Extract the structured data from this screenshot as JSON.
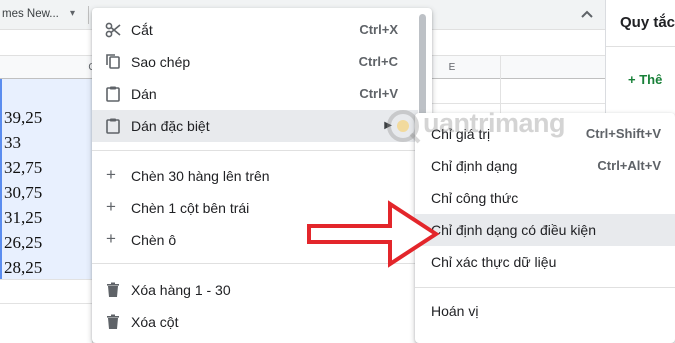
{
  "toolbar": {
    "font_name": "mes New...",
    "font_caret": "▾"
  },
  "columns": {
    "c_label": "C",
    "e_label": "E"
  },
  "cells": [
    "39,25",
    "33",
    "32,75",
    "30,75",
    "31,25",
    "26,25",
    "28,25"
  ],
  "side_panel": {
    "title": "Quy tắc",
    "add_label": "+ Thê"
  },
  "context_menu": {
    "items": [
      {
        "label": "Cắt",
        "shortcut": "Ctrl+X",
        "icon": "scissors-icon"
      },
      {
        "label": "Sao chép",
        "shortcut": "Ctrl+C",
        "icon": "copy-icon"
      },
      {
        "label": "Dán",
        "shortcut": "Ctrl+V",
        "icon": "clipboard-icon"
      },
      {
        "label": "Dán đặc biệt",
        "shortcut": "",
        "icon": "clipboard-icon",
        "submenu_arrow": "▶"
      },
      {
        "label": "Chèn 30 hàng lên trên",
        "icon": "plus-icon"
      },
      {
        "label": "Chèn 1 cột bên trái",
        "icon": "plus-icon"
      },
      {
        "label": "Chèn ô",
        "icon": "plus-icon"
      },
      {
        "label": "Xóa hàng 1 - 30",
        "icon": "trash-icon"
      },
      {
        "label": "Xóa cột",
        "icon": "trash-icon"
      }
    ]
  },
  "submenu": {
    "items": [
      {
        "label": "Chỉ giá trị",
        "shortcut": "Ctrl+Shift+V"
      },
      {
        "label": "Chỉ định dạng",
        "shortcut": "Ctrl+Alt+V"
      },
      {
        "label": "Chỉ công thức",
        "shortcut": ""
      },
      {
        "label": "Chỉ định dạng có điều kiện",
        "shortcut": ""
      },
      {
        "label": "Chỉ xác thực dữ liệu",
        "shortcut": ""
      },
      {
        "label": "Hoán vị",
        "shortcut": ""
      }
    ]
  },
  "watermark": {
    "text": "uantrimang",
    "icon": "quantrimang-logo-icon"
  },
  "colors": {
    "selection": "#e8f0fe",
    "highlight": "#e8eaed",
    "arrow": "#e3262b",
    "add_green": "#188038"
  }
}
